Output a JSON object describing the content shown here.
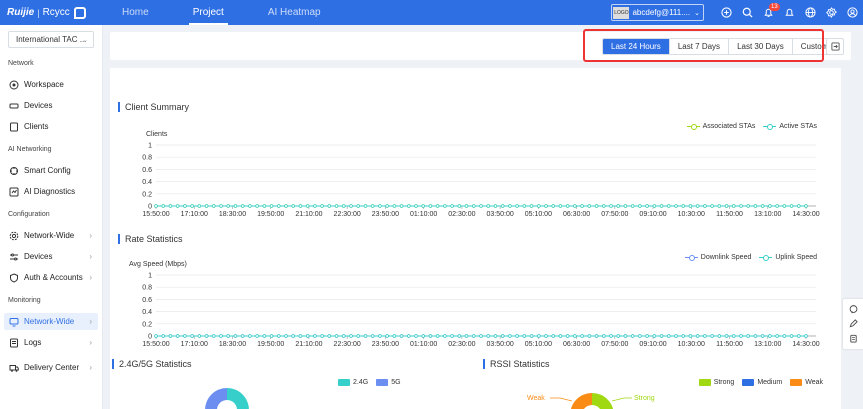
{
  "brand": {
    "name": "Ruijie",
    "product": "Rcycc"
  },
  "nav": {
    "tabs": [
      {
        "label": "Home"
      },
      {
        "label": "Project"
      },
      {
        "label": "AI Heatmap"
      }
    ],
    "active": "Project"
  },
  "topbar": {
    "logo_text": "LOGO",
    "account": "abcdefg@111....",
    "notification_count": "13"
  },
  "sidebar": {
    "project": "International TAC ...",
    "sections": {
      "network": "Network",
      "ai": "AI Networking",
      "config": "Configuration",
      "monitoring": "Monitoring"
    },
    "items": {
      "workspace": "Workspace",
      "devices": "Devices",
      "clients": "Clients",
      "smart_config": "Smart Config",
      "ai_diagnostics": "AI Diagnostics",
      "network_wide": "Network-Wide",
      "cfg_devices": "Devices",
      "auth": "Auth & Accounts",
      "mon_network_wide": "Network-Wide",
      "logs": "Logs",
      "delivery": "Delivery Center"
    }
  },
  "time_range": {
    "options": [
      "Last 24 Hours",
      "Last 7 Days",
      "Last 30 Days",
      "Custom"
    ],
    "selected": "Last 24 Hours"
  },
  "colors": {
    "primary": "#2f6fe4",
    "highlight": "#e33333",
    "associated": "#a0d911",
    "active": "#36cfc9",
    "downlink": "#6b8ef0",
    "uplink": "#36cfc9",
    "g24": "#36cfc9",
    "g5": "#6b8ef0",
    "strong": "#a0d911",
    "medium": "#2f6fe4",
    "weak": "#fa8c16"
  },
  "client_summary": {
    "title": "Client Summary"
  },
  "rate_statistics": {
    "title": "Rate Statistics"
  },
  "band_statistics": {
    "title": "2.4G/5G Statistics",
    "legend": [
      "2.4G",
      "5G"
    ]
  },
  "rssi_statistics": {
    "title": "RSSI Statistics",
    "legend": [
      "Strong",
      "Medium",
      "Weak"
    ],
    "labels": {
      "weak": "Weak",
      "strong": "Strong"
    }
  },
  "chart_data": [
    {
      "type": "line",
      "title": "Client Summary",
      "ylabel": "Clients",
      "ylim": [
        0,
        1
      ],
      "yticks": [
        "0",
        "0.2",
        "0.4",
        "0.6",
        "0.8",
        "1"
      ],
      "x": [
        "15:50:00",
        "17:10:00",
        "18:30:00",
        "19:50:00",
        "21:10:00",
        "22:30:00",
        "23:50:00",
        "01:10:00",
        "02:30:00",
        "03:50:00",
        "05:10:00",
        "06:30:00",
        "07:50:00",
        "09:10:00",
        "10:30:00",
        "11:50:00",
        "13:10:00",
        "14:30:00"
      ],
      "series": [
        {
          "name": "Associated STAs",
          "values": [
            0,
            0,
            0,
            0,
            0,
            0,
            0,
            0,
            0,
            0,
            0,
            0,
            0,
            0,
            0,
            0,
            0,
            0
          ]
        },
        {
          "name": "Active STAs",
          "values": [
            0,
            0,
            0,
            0,
            0,
            0,
            0,
            0,
            0,
            0,
            0,
            0,
            0,
            0,
            0,
            0,
            0,
            0
          ]
        }
      ]
    },
    {
      "type": "line",
      "title": "Rate Statistics",
      "ylabel": "Avg Speed (Mbps)",
      "ylim": [
        0,
        1
      ],
      "yticks": [
        "0",
        "0.2",
        "0.4",
        "0.6",
        "0.8",
        "1"
      ],
      "x": [
        "15:50:00",
        "17:10:00",
        "18:30:00",
        "19:50:00",
        "21:10:00",
        "22:30:00",
        "23:50:00",
        "01:10:00",
        "02:30:00",
        "03:50:00",
        "05:10:00",
        "06:30:00",
        "07:50:00",
        "09:10:00",
        "10:30:00",
        "11:50:00",
        "13:10:00",
        "14:30:00"
      ],
      "series": [
        {
          "name": "Downlink Speed",
          "values": [
            0,
            0,
            0,
            0,
            0,
            0,
            0,
            0,
            0,
            0,
            0,
            0,
            0,
            0,
            0,
            0,
            0,
            0
          ]
        },
        {
          "name": "Uplink Speed",
          "values": [
            0,
            0,
            0,
            0,
            0,
            0,
            0,
            0,
            0,
            0,
            0,
            0,
            0,
            0,
            0,
            0,
            0,
            0
          ]
        }
      ]
    }
  ]
}
